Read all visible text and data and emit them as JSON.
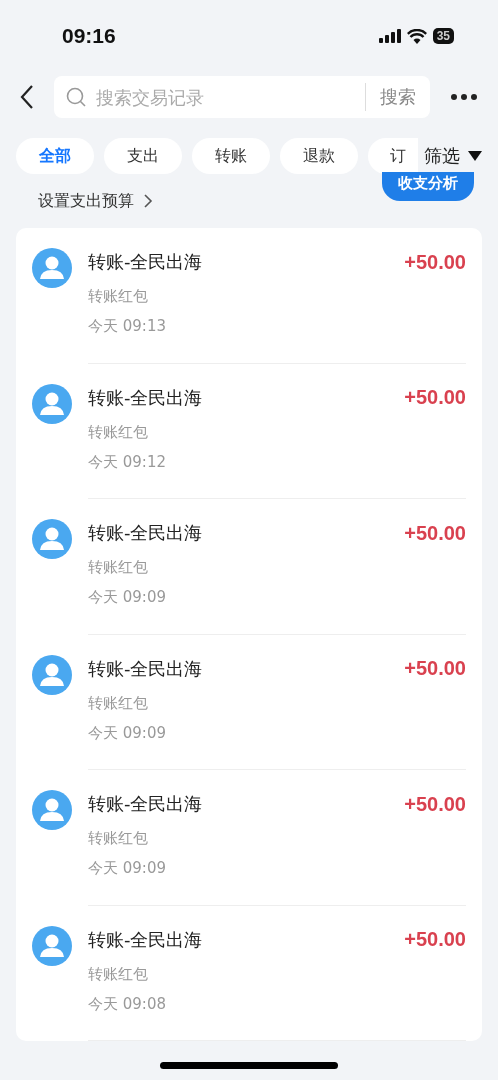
{
  "status_bar": {
    "time": "09:16",
    "battery": "35"
  },
  "nav": {
    "search_placeholder": "搜索交易记录",
    "search_button": "搜索"
  },
  "tabs": [
    {
      "label": "全部",
      "selected": true
    },
    {
      "label": "支出",
      "selected": false
    },
    {
      "label": "转账",
      "selected": false
    },
    {
      "label": "退款",
      "selected": false
    },
    {
      "label": "订",
      "selected": false
    }
  ],
  "filter": "筛选",
  "budget_link": "设置支出预算",
  "analysis_button": "收支分析",
  "transactions": [
    {
      "title": "转账-全民出海",
      "subtitle": "转账红包",
      "time": "今天 09:13",
      "amount": "+50.00"
    },
    {
      "title": "转账-全民出海",
      "subtitle": "转账红包",
      "time": "今天 09:12",
      "amount": "+50.00"
    },
    {
      "title": "转账-全民出海",
      "subtitle": "转账红包",
      "time": "今天 09:09",
      "amount": "+50.00"
    },
    {
      "title": "转账-全民出海",
      "subtitle": "转账红包",
      "time": "今天 09:09",
      "amount": "+50.00"
    },
    {
      "title": "转账-全民出海",
      "subtitle": "转账红包",
      "time": "今天 09:09",
      "amount": "+50.00"
    },
    {
      "title": "转账-全民出海",
      "subtitle": "转账红包",
      "time": "今天 09:08",
      "amount": "+50.00"
    }
  ]
}
